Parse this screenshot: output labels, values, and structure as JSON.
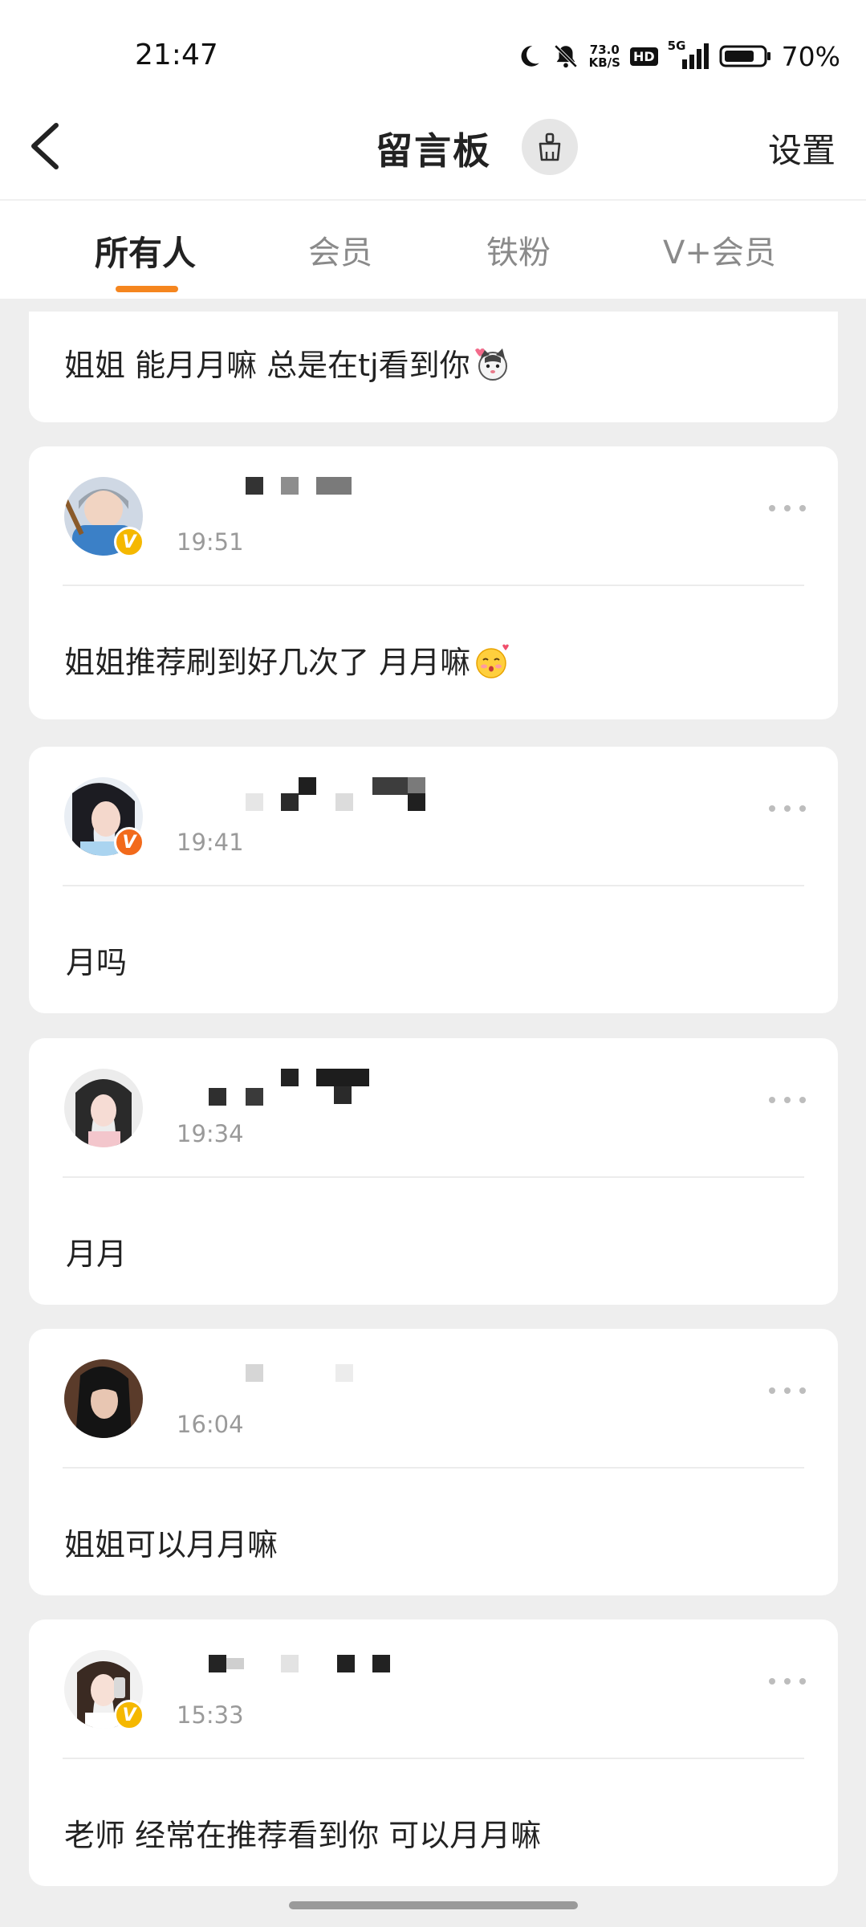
{
  "status_bar": {
    "time": "21:47",
    "speed_value": "73.0",
    "speed_unit": "KB/S",
    "hd_label": "HD",
    "network": "5G",
    "battery": "70%"
  },
  "header": {
    "title": "留言板",
    "settings_label": "设置"
  },
  "tabs": [
    {
      "label": "所有人",
      "active": true
    },
    {
      "label": "会员",
      "active": false
    },
    {
      "label": "铁粉",
      "active": false
    },
    {
      "label": "V+会员",
      "active": false
    }
  ],
  "first_card": {
    "text": "姐姐 能月月嘛 总是在tj看到你"
  },
  "comments": [
    {
      "time": "19:51",
      "text": "姐姐推荐刷到好几次了 月月嘛",
      "badge": "V",
      "badge_color": "#f5b800"
    },
    {
      "time": "19:41",
      "text": "月吗",
      "badge": "V",
      "badge_color": "#f26a1b"
    },
    {
      "time": "19:34",
      "text": "月月"
    },
    {
      "time": "16:04",
      "text": "姐姐可以月月嘛"
    },
    {
      "time": "15:33",
      "text": "老师 经常在推荐看到你 可以月月嘛",
      "badge": "V",
      "badge_color": "#f5b800"
    }
  ],
  "colors": {
    "accent": "#f5861f",
    "background": "#eeeeee"
  }
}
